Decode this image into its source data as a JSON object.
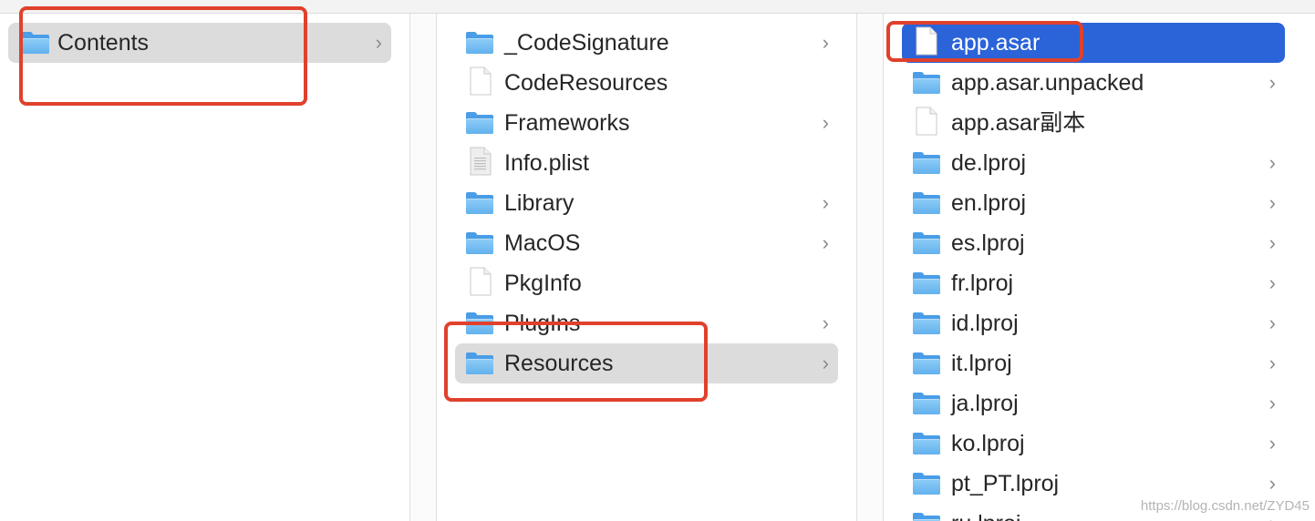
{
  "columns": [
    {
      "items": [
        {
          "name": "Contents",
          "kind": "folder",
          "has_children": true,
          "selected": "gray"
        }
      ]
    },
    {
      "items": [
        {
          "name": "_CodeSignature",
          "kind": "folder",
          "has_children": true
        },
        {
          "name": "CodeResources",
          "kind": "file",
          "has_children": false
        },
        {
          "name": "Frameworks",
          "kind": "folder",
          "has_children": true
        },
        {
          "name": "Info.plist",
          "kind": "plist",
          "has_children": false
        },
        {
          "name": "Library",
          "kind": "folder",
          "has_children": true
        },
        {
          "name": "MacOS",
          "kind": "folder",
          "has_children": true
        },
        {
          "name": "PkgInfo",
          "kind": "file",
          "has_children": false
        },
        {
          "name": "PlugIns",
          "kind": "folder",
          "has_children": true
        },
        {
          "name": "Resources",
          "kind": "folder",
          "has_children": true,
          "selected": "gray"
        }
      ]
    },
    {
      "items": [
        {
          "name": "app.asar",
          "kind": "file",
          "has_children": false,
          "selected": "blue"
        },
        {
          "name": "app.asar.unpacked",
          "kind": "folder",
          "has_children": true
        },
        {
          "name": "app.asar副本",
          "kind": "file",
          "has_children": false
        },
        {
          "name": "de.lproj",
          "kind": "folder",
          "has_children": true
        },
        {
          "name": "en.lproj",
          "kind": "folder",
          "has_children": true
        },
        {
          "name": "es.lproj",
          "kind": "folder",
          "has_children": true
        },
        {
          "name": "fr.lproj",
          "kind": "folder",
          "has_children": true
        },
        {
          "name": "id.lproj",
          "kind": "folder",
          "has_children": true
        },
        {
          "name": "it.lproj",
          "kind": "folder",
          "has_children": true
        },
        {
          "name": "ja.lproj",
          "kind": "folder",
          "has_children": true
        },
        {
          "name": "ko.lproj",
          "kind": "folder",
          "has_children": true
        },
        {
          "name": "pt_PT.lproj",
          "kind": "folder",
          "has_children": true
        },
        {
          "name": "ru.lproj",
          "kind": "folder",
          "has_children": true
        }
      ]
    }
  ],
  "chevron_glyph": "›",
  "watermark": "https://blog.csdn.net/ZYD45",
  "colors": {
    "selection_blue": "#2b63d9",
    "selection_gray": "#dcdcdc",
    "annotation_red": "#e0412c",
    "folder_blue": "#62b1ee"
  }
}
